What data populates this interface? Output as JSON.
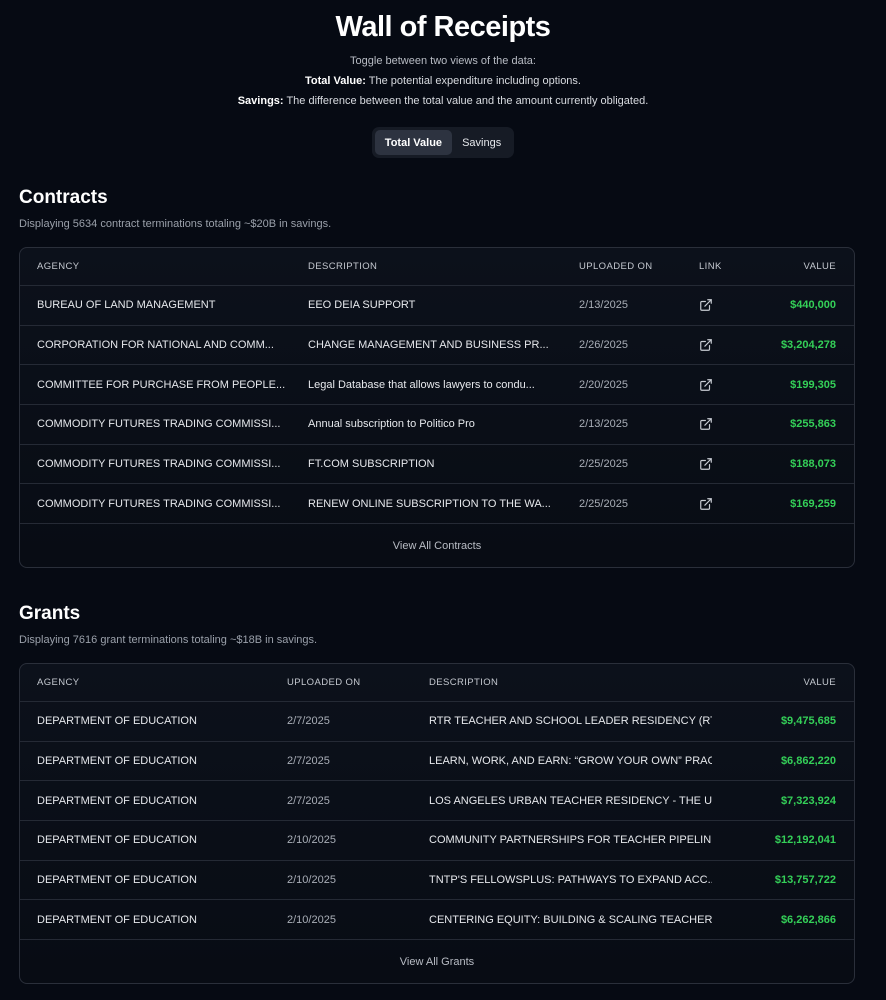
{
  "header": {
    "title": "Wall of Receipts",
    "subtitle": "Toggle between two views of the data:",
    "total_value_term": "Total Value:",
    "total_value_def": "The potential expenditure including options.",
    "savings_term": "Savings:",
    "savings_def": "The difference between the total value and the amount currently obligated."
  },
  "toggle": {
    "options": [
      "Total Value",
      "Savings"
    ],
    "selected": "Total Value"
  },
  "contracts": {
    "title": "Contracts",
    "summary": "Displaying 5634 contract terminations totaling ~$20B in savings.",
    "columns": [
      "AGENCY",
      "DESCRIPTION",
      "UPLOADED ON",
      "LINK",
      "VALUE"
    ],
    "rows": [
      {
        "agency": "BUREAU OF LAND MANAGEMENT",
        "description": "EEO DEIA SUPPORT",
        "uploaded": "2/13/2025",
        "value": "$440,000"
      },
      {
        "agency": "CORPORATION FOR NATIONAL AND COMM...",
        "description": "CHANGE MANAGEMENT AND BUSINESS PR...",
        "uploaded": "2/26/2025",
        "value": "$3,204,278"
      },
      {
        "agency": "COMMITTEE FOR PURCHASE FROM PEOPLE...",
        "description": "Legal Database that allows lawyers to condu...",
        "uploaded": "2/20/2025",
        "value": "$199,305"
      },
      {
        "agency": "COMMODITY FUTURES TRADING COMMISSI...",
        "description": "Annual subscription to Politico Pro",
        "uploaded": "2/13/2025",
        "value": "$255,863"
      },
      {
        "agency": "COMMODITY FUTURES TRADING COMMISSI...",
        "description": "FT.COM SUBSCRIPTION",
        "uploaded": "2/25/2025",
        "value": "$188,073"
      },
      {
        "agency": "COMMODITY FUTURES TRADING COMMISSI...",
        "description": "RENEW ONLINE SUBSCRIPTION TO THE WA...",
        "uploaded": "2/25/2025",
        "value": "$169,259"
      }
    ],
    "view_all": "View All Contracts"
  },
  "grants": {
    "title": "Grants",
    "summary": "Displaying 7616 grant terminations totaling ~$18B in savings.",
    "columns": [
      "AGENCY",
      "UPLOADED ON",
      "DESCRIPTION",
      "VALUE"
    ],
    "rows": [
      {
        "agency": "DEPARTMENT OF EDUCATION",
        "uploaded": "2/7/2025",
        "description": "RTR TEACHER AND SCHOOL LEADER RESIDENCY (RT...",
        "value": "$9,475,685"
      },
      {
        "agency": "DEPARTMENT OF EDUCATION",
        "uploaded": "2/7/2025",
        "description": "LEARN, WORK, AND EARN: “GROW YOUR OWN” PRAC...",
        "value": "$6,862,220"
      },
      {
        "agency": "DEPARTMENT OF EDUCATION",
        "uploaded": "2/7/2025",
        "description": "LOS ANGELES URBAN TEACHER RESIDENCY - THE U...",
        "value": "$7,323,924"
      },
      {
        "agency": "DEPARTMENT OF EDUCATION",
        "uploaded": "2/10/2025",
        "description": "COMMUNITY PARTNERSHIPS FOR TEACHER PIPELINE",
        "value": "$12,192,041"
      },
      {
        "agency": "DEPARTMENT OF EDUCATION",
        "uploaded": "2/10/2025",
        "description": "TNTP'S FELLOWSPLUS: PATHWAYS TO EXPAND ACC...",
        "value": "$13,757,722"
      },
      {
        "agency": "DEPARTMENT OF EDUCATION",
        "uploaded": "2/10/2025",
        "description": "CENTERING EQUITY: BUILDING & SCALING TEACHER ...",
        "value": "$6,262,866"
      }
    ],
    "view_all": "View All Grants"
  },
  "colors": {
    "background": "#060a13",
    "money_green": "#34d058",
    "toggle_active": "#2d3340"
  },
  "icons": {
    "link": "external-link-icon"
  }
}
